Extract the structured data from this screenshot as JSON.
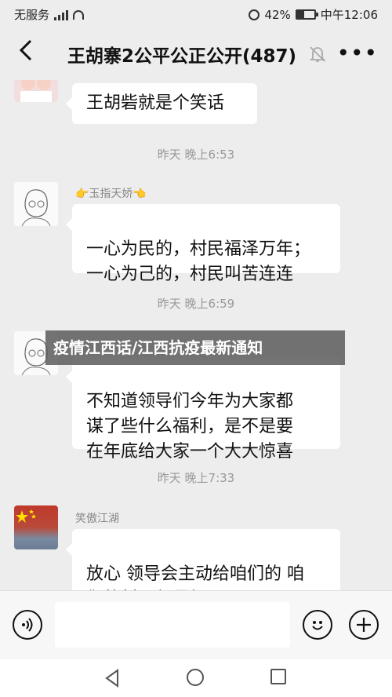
{
  "status": {
    "carrier": "无服务",
    "battery_percent": "42%",
    "battery_level": 0.42,
    "time": "中午12:06"
  },
  "header": {
    "back_icon": "chevron-left-icon",
    "title": "王胡寨2公平公正公开(487)",
    "mute_icon": "bell-muted-icon",
    "more_icon": "ellipsis-icon",
    "more_label": "•••"
  },
  "messages": [
    {
      "text": "王胡砦就是个笑话"
    },
    {
      "timestamp": "昨天 晚上6:53",
      "sender": "👉玉指天娇👈",
      "text": "一心为民的，村民福泽万年；\n一心为己的，村民叫苦连连"
    },
    {
      "timestamp": "昨天 晚上6:59",
      "text": "不知道领导们今年为大家都\n谋了些什么福利，是不是要\n在年底给大家一个大大惊喜"
    },
    {
      "timestamp": "昨天 晚上7:33",
      "sender": "笑傲江湖",
      "text": "放心 领导会主动给咱们的 咱\n们的村干部最好了"
    }
  ],
  "overlay": {
    "caption": "疫情江西话/江西抗疫最新通知"
  },
  "input_bar": {
    "voice_icon": "voice-icon",
    "emoji_icon": "emoji-icon",
    "plus_icon": "plus-icon"
  },
  "navbar": {
    "back_icon": "triangle-back-icon",
    "home_icon": "circle-home-icon",
    "recent_icon": "square-recent-icon"
  }
}
